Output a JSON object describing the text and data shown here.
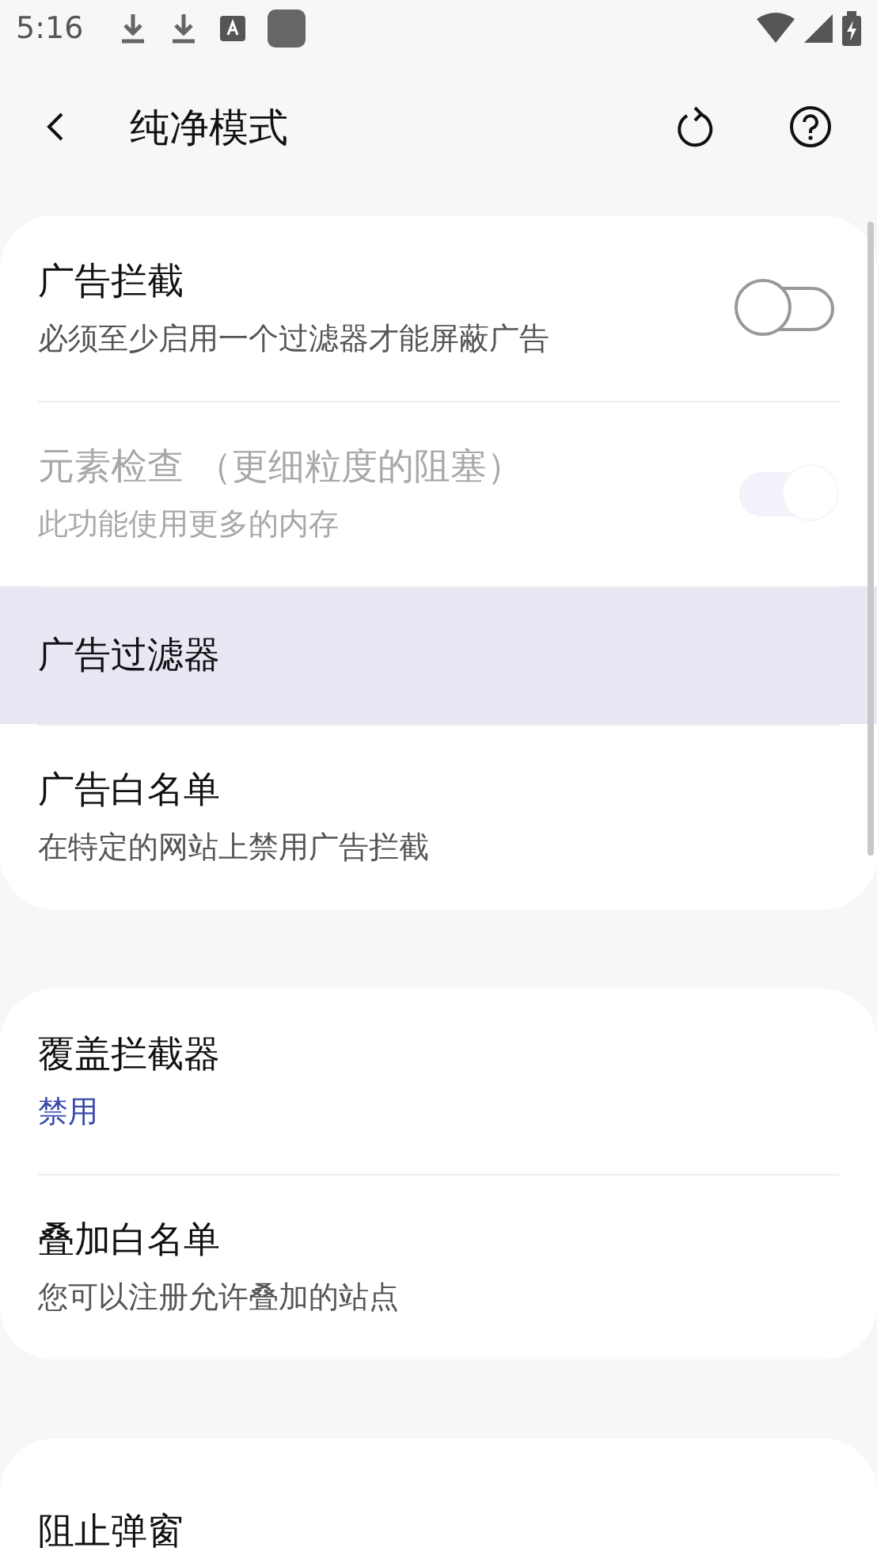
{
  "status_bar": {
    "time": "5:16"
  },
  "toolbar": {
    "title": "纯净模式"
  },
  "groups": [
    {
      "items": [
        {
          "kind": "switch",
          "title": "广告拦截",
          "summary": "必须至少启用一个过滤器才能屏蔽广告",
          "on": false,
          "disabled": false,
          "selected": false
        },
        {
          "kind": "switch",
          "title": "元素检查 （更细粒度的阻塞）",
          "summary": "此功能使用更多的内存",
          "on": true,
          "disabled": true,
          "selected": false
        },
        {
          "kind": "link",
          "title": "广告过滤器",
          "selected": true
        },
        {
          "kind": "link",
          "title": "广告白名单",
          "summary": "在特定的网站上禁用广告拦截",
          "selected": false
        }
      ]
    },
    {
      "items": [
        {
          "kind": "choice",
          "title": "覆盖拦截器",
          "summary": "禁用",
          "selected": false
        },
        {
          "kind": "link",
          "title": "叠加白名单",
          "summary": "您可以注册允许叠加的站点",
          "selected": false
        }
      ]
    },
    {
      "items": [
        {
          "kind": "choice",
          "title": "阻止弹窗",
          "selected": false
        }
      ]
    }
  ]
}
